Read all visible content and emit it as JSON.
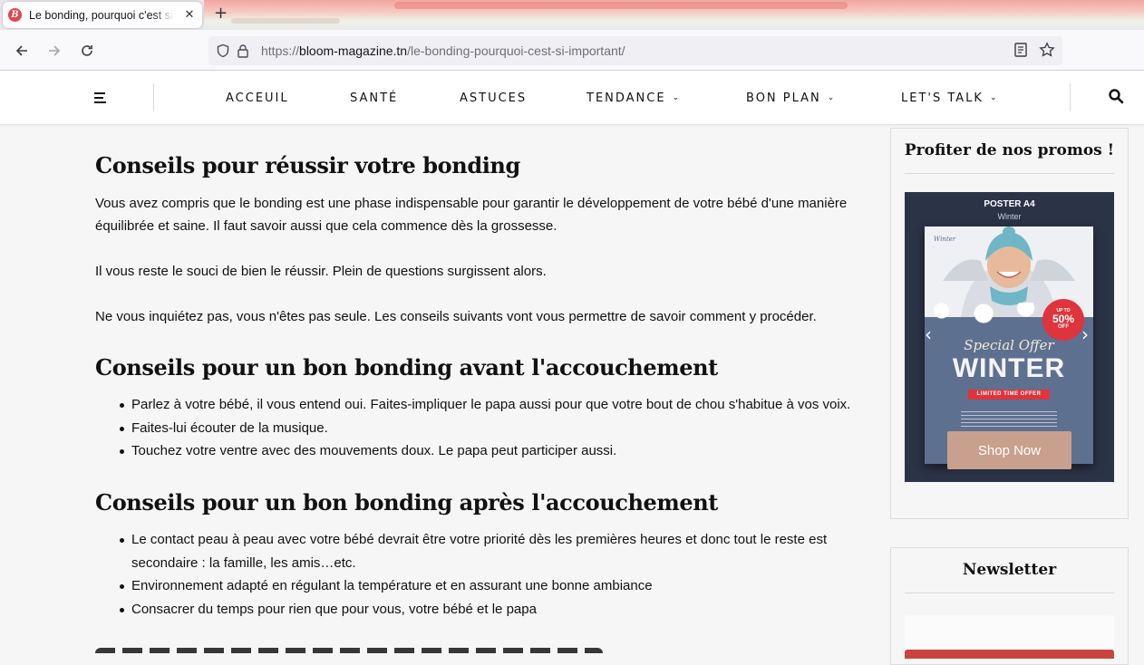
{
  "browser": {
    "tab_title": "Le bonding, pourquoi c'est si important",
    "tab_favicon_letter": "B",
    "url_scheme": "https://",
    "url_domain": "bloom-magazine.tn",
    "url_path": "/le-bonding-pourquoi-cest-si-important/"
  },
  "nav": {
    "items": [
      {
        "label": "ACCEUIL",
        "dropdown": false
      },
      {
        "label": "SANTÉ",
        "dropdown": false
      },
      {
        "label": "ASTUCES",
        "dropdown": false
      },
      {
        "label": "TENDANCE",
        "dropdown": true
      },
      {
        "label": "BON PLAN",
        "dropdown": true
      },
      {
        "label": "LET'S TALK",
        "dropdown": true
      }
    ]
  },
  "article": {
    "h1": "Conseils pour réussir votre bonding",
    "p1": "Vous avez compris que le bonding  est une phase indispensable pour garantir le développement de votre bébé d'une manière équilibrée et saine. Il faut savoir aussi que cela commence dès la grossesse.",
    "p2": " Il vous reste le souci de bien le réussir. Plein de questions surgissent alors.",
    "p3": " Ne vous inquiétez pas, vous n'êtes pas seule. Les conseils suivants vont vous permettre de savoir comment y procéder.",
    "h2": "Conseils pour un bon bonding avant l'accouchement",
    "list1": [
      "Parlez à votre bébé, il vous entend oui. Faites-impliquer le papa aussi pour que votre bout de chou s'habitue à vos voix.",
      "Faites-lui écouter de la musique.",
      "Touchez votre ventre avec des mouvements doux. Le papa peut participer aussi."
    ],
    "h3": "Conseils pour un bon bonding après l'accouchement",
    "list2": [
      "Le contact peau à peau avec votre bébé devrait être votre priorité dès les premières heures et donc tout le reste est secondaire : la famille, les amis…etc.",
      "Environnement adapté en régulant la température et en assurant une bonne ambiance",
      "Consacrer du temps pour rien que pour vous, votre bébé et le papa"
    ]
  },
  "sidebar": {
    "promo_title": "Profiter de nos promos !",
    "banner": {
      "title": "POSTER A4",
      "subtitle": "Winter",
      "poster_logo": "Winter",
      "discount_top": "UP TO",
      "discount": "50%",
      "discount_bottom": "OFF",
      "special": "Special Offer",
      "headline": "WINTER",
      "ribbon": "LIMITED TIME OFFER",
      "cta": "Shop Now"
    },
    "newsletter_title": "Newsletter"
  },
  "colors": {
    "accent_red": "#e0454c",
    "cta_bg": "#c9a08d",
    "banner_bg": "#2b3347"
  }
}
